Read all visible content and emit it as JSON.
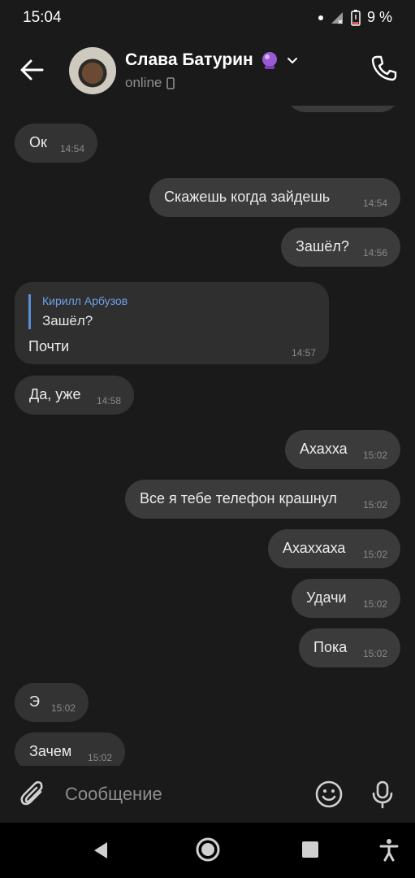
{
  "status": {
    "time": "15:04",
    "battery": "9 %"
  },
  "header": {
    "name": "Слава Батурин",
    "status": "online"
  },
  "messages": [
    {
      "dir": "in",
      "text": "Ок",
      "time": "14:54"
    },
    {
      "dir": "out",
      "text": "Скажешь когда зайдешь",
      "time": "14:54"
    },
    {
      "dir": "out",
      "text": "Зашёл?",
      "time": "14:56"
    },
    {
      "dir": "in",
      "reply_name": "Кирилл Арбузов",
      "reply_text": "Зашёл?",
      "text": "Почти",
      "time": "14:57"
    },
    {
      "dir": "in",
      "text": "Да, уже",
      "time": "14:58"
    },
    {
      "dir": "out",
      "text": "Ахахха",
      "time": "15:02"
    },
    {
      "dir": "out",
      "text": "Все я тебе телефон крашнул",
      "time": "15:02"
    },
    {
      "dir": "out",
      "text": "Ахаххаха",
      "time": "15:02"
    },
    {
      "dir": "out",
      "text": "Удачи",
      "time": "15:02"
    },
    {
      "dir": "out",
      "text": "Пока",
      "time": "15:02"
    },
    {
      "dir": "in",
      "text": "Э",
      "time": "15:02"
    },
    {
      "dir": "in",
      "text": "Зачем",
      "time": "15:02"
    }
  ],
  "composer": {
    "placeholder": "Сообщение"
  },
  "icons": {
    "back": "arrow-left-icon",
    "call": "phone-icon",
    "attach": "paperclip-icon",
    "emoji": "smiley-icon",
    "mic": "microphone-icon",
    "crystal_ball": "crystal-ball-icon",
    "phone_device": "phone-device-icon",
    "chevron": "chevron-down-icon"
  },
  "colors": {
    "background": "#1a1a1a",
    "bubble": "#333333",
    "reply_accent": "#6ea1e8"
  }
}
